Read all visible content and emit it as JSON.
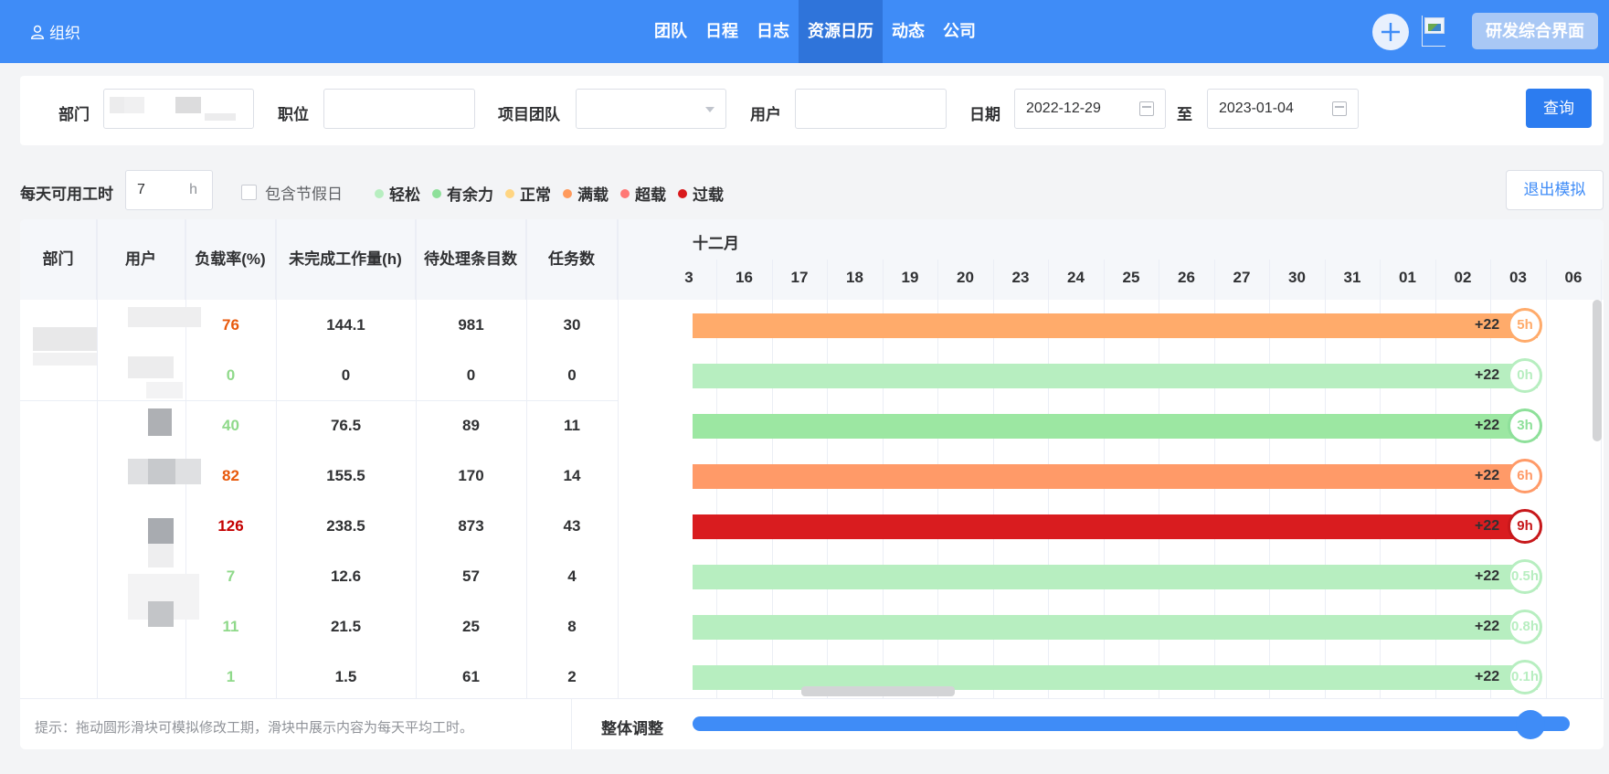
{
  "topbar": {
    "org_label": "组织",
    "nav": [
      {
        "label": "团队",
        "active": false
      },
      {
        "label": "日程",
        "active": false
      },
      {
        "label": "日志",
        "active": false
      },
      {
        "label": "资源日历",
        "active": true
      },
      {
        "label": "动态",
        "active": false
      },
      {
        "label": "公司",
        "active": false
      }
    ],
    "system_button": "研发综合界面",
    "colors": {
      "bar": "#3f8cf7",
      "active": "#2f74da"
    }
  },
  "filter": {
    "dept_label": "部门",
    "position_label": "职位",
    "team_label": "项目团队",
    "user_label": "用户",
    "date_label": "日期",
    "date_from": "2022-12-29",
    "date_sep": "至",
    "date_to": "2023-01-04",
    "query_button": "查询"
  },
  "controls": {
    "daily_hours_label": "每天可用工时",
    "daily_hours_value": "7",
    "daily_hours_unit": "h",
    "include_holidays_label": "包含节假日",
    "exit_button": "退出模拟",
    "legend": [
      {
        "label": "轻松",
        "color": "#b7eec0"
      },
      {
        "label": "有余力",
        "color": "#8ee09a"
      },
      {
        "label": "正常",
        "color": "#ffd582"
      },
      {
        "label": "满载",
        "color": "#ff9a5c"
      },
      {
        "label": "超载",
        "color": "#ff7875"
      },
      {
        "label": "过载",
        "color": "#d9191c"
      }
    ]
  },
  "table": {
    "headers": [
      "部门",
      "用户",
      "负载率(%)",
      "未完成工作量(h)",
      "待处理条目数",
      "任务数"
    ],
    "rows": [
      {
        "load": "76",
        "load_color": "#e8590c",
        "remaining": "144.1",
        "pending": "981",
        "tasks": "30",
        "bar_color": "#ffab6b",
        "extra": "+22",
        "knob": "5h",
        "knob_color": "#ffab6b"
      },
      {
        "load": "0",
        "load_color": "#8fd98a",
        "remaining": "0",
        "pending": "0",
        "tasks": "0",
        "bar_color": "#b7eec0",
        "extra": "+22",
        "knob": "0h",
        "knob_color": "#b7eec0"
      },
      {
        "load": "40",
        "load_color": "#8fd98a",
        "remaining": "76.5",
        "pending": "89",
        "tasks": "11",
        "bar_color": "#9ce7a2",
        "extra": "+22",
        "knob": "3h",
        "knob_color": "#8ee09a"
      },
      {
        "load": "82",
        "load_color": "#e8590c",
        "remaining": "155.5",
        "pending": "170",
        "tasks": "14",
        "bar_color": "#ff9a68",
        "extra": "+22",
        "knob": "6h",
        "knob_color": "#ff9a68"
      },
      {
        "load": "126",
        "load_color": "#c40000",
        "remaining": "238.5",
        "pending": "873",
        "tasks": "43",
        "bar_color": "#d91c1f",
        "extra": "+22",
        "knob": "9h",
        "knob_color": "#c7181b"
      },
      {
        "load": "7",
        "load_color": "#8fd98a",
        "remaining": "12.6",
        "pending": "57",
        "tasks": "4",
        "bar_color": "#b7eec0",
        "extra": "+22",
        "knob": "0.5h",
        "knob_color": "#b7eec0"
      },
      {
        "load": "11",
        "load_color": "#8fd98a",
        "remaining": "21.5",
        "pending": "25",
        "tasks": "8",
        "bar_color": "#b7eec0",
        "extra": "+22",
        "knob": "0.8h",
        "knob_color": "#b7eec0"
      },
      {
        "load": "1",
        "load_color": "#8fd98a",
        "remaining": "1.5",
        "pending": "61",
        "tasks": "2",
        "bar_color": "#b7eec0",
        "extra": "+22",
        "knob": "0.1h",
        "knob_color": "#b7eec0"
      }
    ]
  },
  "gantt": {
    "month": "十二月",
    "days": [
      "3",
      "16",
      "17",
      "18",
      "19",
      "20",
      "23",
      "24",
      "25",
      "26",
      "27",
      "30",
      "31",
      "01",
      "02",
      "03",
      "06"
    ]
  },
  "footer": {
    "hint": "提示：拖动圆形滑块可模拟修改工期，滑块中展示内容为每天平均工时。",
    "adjust_label": "整体调整"
  }
}
